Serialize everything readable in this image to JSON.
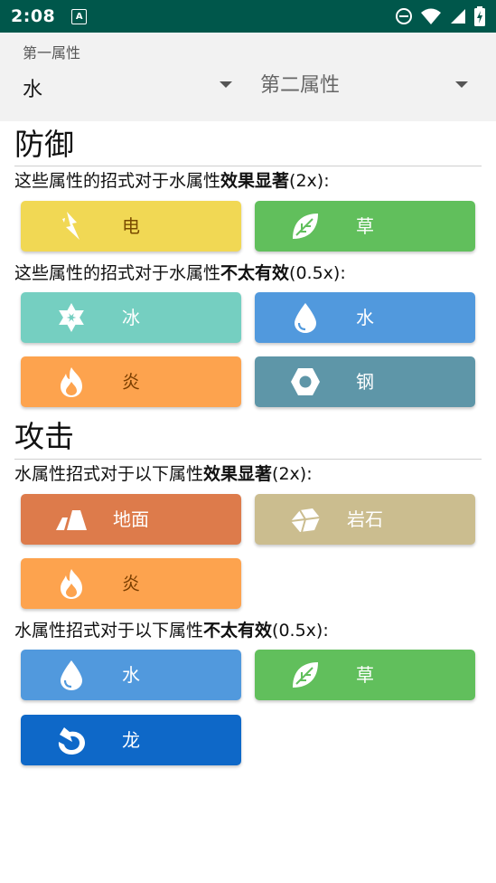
{
  "status_bar": {
    "time": "2:08",
    "notification": "A"
  },
  "selectors": {
    "first": {
      "label": "第一属性",
      "value": "水"
    },
    "second": {
      "placeholder": "第二属性"
    }
  },
  "defense": {
    "title": "防御",
    "weak": {
      "prefix": "这些属性的招式对于水属性",
      "bold": "效果显著",
      "suffix": "(2x):",
      "types": [
        {
          "label": "电",
          "icon": "lightning-icon",
          "color": "#f1d854"
        },
        {
          "label": "草",
          "icon": "leaf-icon",
          "color": "#61bf5c"
        }
      ]
    },
    "resist": {
      "prefix": "这些属性的招式对于水属性",
      "bold": "不太有效",
      "suffix": "(0.5x):",
      "types": [
        {
          "label": "冰",
          "icon": "snowflake-icon",
          "color": "#75cfc1"
        },
        {
          "label": "水",
          "icon": "water-drop-icon",
          "color": "#5199dd"
        },
        {
          "label": "炎",
          "icon": "flame-icon",
          "color": "#fda34e"
        },
        {
          "label": "钢",
          "icon": "hex-nut-icon",
          "color": "#5e96a8"
        }
      ]
    }
  },
  "attack": {
    "title": "攻击",
    "strong": {
      "prefix": "水属性招式对于以下属性",
      "bold": "效果显著",
      "suffix": "(2x):",
      "types": [
        {
          "label": "地面",
          "icon": "ground-icon",
          "color": "#dd7b4b"
        },
        {
          "label": "岩石",
          "icon": "rock-icon",
          "color": "#cbbd8f"
        },
        {
          "label": "炎",
          "icon": "flame-icon",
          "color": "#fda34e"
        }
      ]
    },
    "weak": {
      "prefix": "水属性招式对于以下属性",
      "bold": "不太有效",
      "suffix": "(0.5x):",
      "types": [
        {
          "label": "水",
          "icon": "water-drop-icon",
          "color": "#5199dd"
        },
        {
          "label": "草",
          "icon": "leaf-icon",
          "color": "#61bf5c"
        },
        {
          "label": "龙",
          "icon": "dragon-icon",
          "color": "#0e68c8"
        }
      ]
    }
  }
}
